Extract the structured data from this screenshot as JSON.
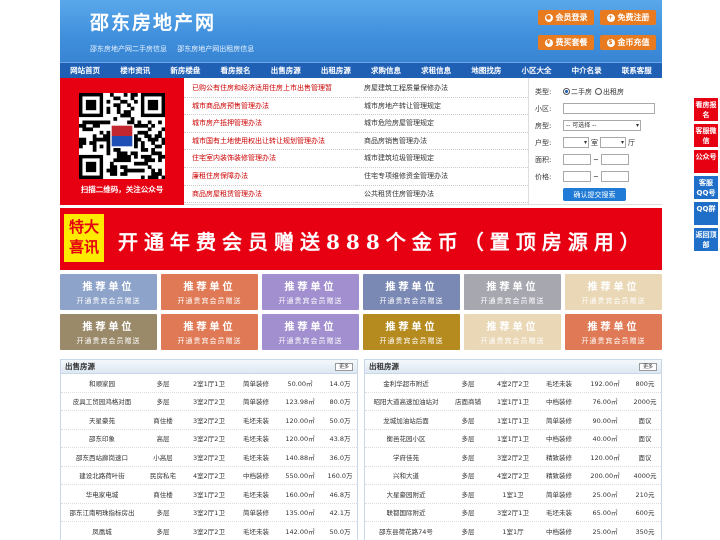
{
  "header": {
    "title": "邵东房地产网",
    "sub_links": [
      "邵东房地产网二手房信息",
      "邵东房地产网出租房信息"
    ],
    "buttons": [
      {
        "label": "会员登录",
        "icon": "user-icon"
      },
      {
        "label": "免费注册",
        "icon": "register-icon"
      },
      {
        "label": "费买套餐",
        "icon": "package-icon"
      },
      {
        "label": "金币充值",
        "icon": "coin-icon"
      }
    ]
  },
  "nav": [
    "网站首页",
    "楼市资讯",
    "新房楼盘",
    "看房报名",
    "出售房源",
    "出租房源",
    "求购信息",
    "求租信息",
    "地图找房",
    "小区大全",
    "中介名录",
    "联系客服"
  ],
  "qr": {
    "caption": "扫描二维码，关注公众号"
  },
  "policies_left": [
    "已购公有住房和经济适用住房上市出售管理暂",
    "城市商品房预售管理办法",
    "城市房产抵押管理办法",
    "城市国有土地使用权出让转让规划管理办法",
    "住宅室内装饰装修管理办法",
    "廉租住房保障办法",
    "商品房屋租赁管理办法"
  ],
  "policies_right": [
    "房屋建筑工程质量保修办法",
    "城市房地产转让管理规定",
    "城市危险房屋管理规定",
    "商品房销售管理办法",
    "城市建筑垃圾管理规定",
    "住宅专项维修资金管理办法",
    "公共租赁住房管理办法"
  ],
  "search": {
    "type_label": "类型:",
    "type_options": [
      "二手房",
      "出租房"
    ],
    "area_label": "小区:",
    "house_label": "房型:",
    "house_select": "-- 可选择 --",
    "unit_label": "户型:",
    "room": "室",
    "hall": "厅",
    "size_label": "面积:",
    "price_label": "价格:",
    "tilde": "~",
    "submit": "确认提交搜索"
  },
  "banner": {
    "tag": "特大喜讯",
    "text": "开通年费会员赠送888个金币（置顶房源用）"
  },
  "ads": {
    "title": "推荐单位",
    "subtitle": "开通贵宾会员赠送",
    "colors": [
      "#8ea3c9",
      "#e07a56",
      "#a18fcf",
      "#7a88b4",
      "#a7a7b0",
      "#e9d7b5",
      "#9a8a6a",
      "#e07a56",
      "#a18fcf",
      "#b58a1f",
      "#e9d7b5",
      "#e07a56"
    ]
  },
  "sale": {
    "title": "出售房源",
    "more": "更多",
    "rows": [
      [
        "和顺家园",
        "多层",
        "2室1厅1卫",
        "简单装修",
        "50.00㎡",
        "14.0万"
      ],
      [
        "皮具工贸园鸿格对面",
        "多层",
        "3室2厅2卫",
        "简单装修",
        "123.98㎡",
        "80.0万"
      ],
      [
        "天星豪苑",
        "商住楼",
        "3室2厅2卫",
        "毛坯未装",
        "120.00㎡",
        "50.0万"
      ],
      [
        "邵东印象",
        "高层",
        "3室2厅2卫",
        "毛坯未装",
        "120.00㎡",
        "43.8万"
      ],
      [
        "邵东西站廊岗速口",
        "小高层",
        "3室2厅2卫",
        "毛坯未装",
        "140.88㎡",
        "36.0万"
      ],
      [
        "建设北路荷叶街",
        "民房私宅",
        "4室2厅2卫",
        "中档装修",
        "550.00㎡",
        "160.0万"
      ],
      [
        "华电家电城",
        "商住楼",
        "3室1厅2卫",
        "毛坯未装",
        "160.00㎡",
        "46.8万"
      ],
      [
        "邵东江南明珠指标房出",
        "多层",
        "3室2厅1卫",
        "简单装修",
        "135.00㎡",
        "42.1万"
      ],
      [
        "凤凰城",
        "多层",
        "3室2厅2卫",
        "毛坯未装",
        "142.00㎡",
        "50.0万"
      ],
      [
        "郑盛凤凰城",
        "多层",
        "3室2厅2卫",
        "毛坯未装",
        "142.00㎡",
        "50.0万"
      ]
    ]
  },
  "rent": {
    "title": "出租房源",
    "more": "更多",
    "rows": [
      [
        "金利华超市附近",
        "多层",
        "4室2厅2卫",
        "毛坯未装",
        "192.00㎡",
        "800元"
      ],
      [
        "昭阳大道高速加油站对",
        "店面商铺",
        "1室1厅1卫",
        "中档装修",
        "76.00㎡",
        "2000元"
      ],
      [
        "龙城加油站后面",
        "多层",
        "1室1厅1卫",
        "简单装修",
        "90.00㎡",
        "面议"
      ],
      [
        "衡邑花园小区",
        "多层",
        "1室1厅1卫",
        "中档装修",
        "40.00㎡",
        "面议"
      ],
      [
        "学府佳苑",
        "多层",
        "3室2厅2卫",
        "精致装修",
        "120.00㎡",
        "面议"
      ],
      [
        "兴和大道",
        "多层",
        "4室2厅2卫",
        "精致装修",
        "200.00㎡",
        "4000元"
      ],
      [
        "大星豪园附近",
        "多层",
        "1室1卫",
        "简单装修",
        "25.00㎡",
        "210元"
      ],
      [
        "联都国际附近",
        "多层",
        "3室2厅1卫",
        "毛坯未装",
        "65.00㎡",
        "600元"
      ],
      [
        "邵东县荷花路74号",
        "多层",
        "1室1厅",
        "中档装修",
        "25.00㎡",
        "350元"
      ],
      [
        "邵东格林春天",
        "多层",
        "3室2厅1卫",
        "精致装修",
        "120.00㎡",
        "666元"
      ]
    ]
  },
  "side": [
    "看房报名",
    "客服微信",
    "公众号",
    "客服QQ号",
    "QQ群",
    "返回顶部"
  ]
}
